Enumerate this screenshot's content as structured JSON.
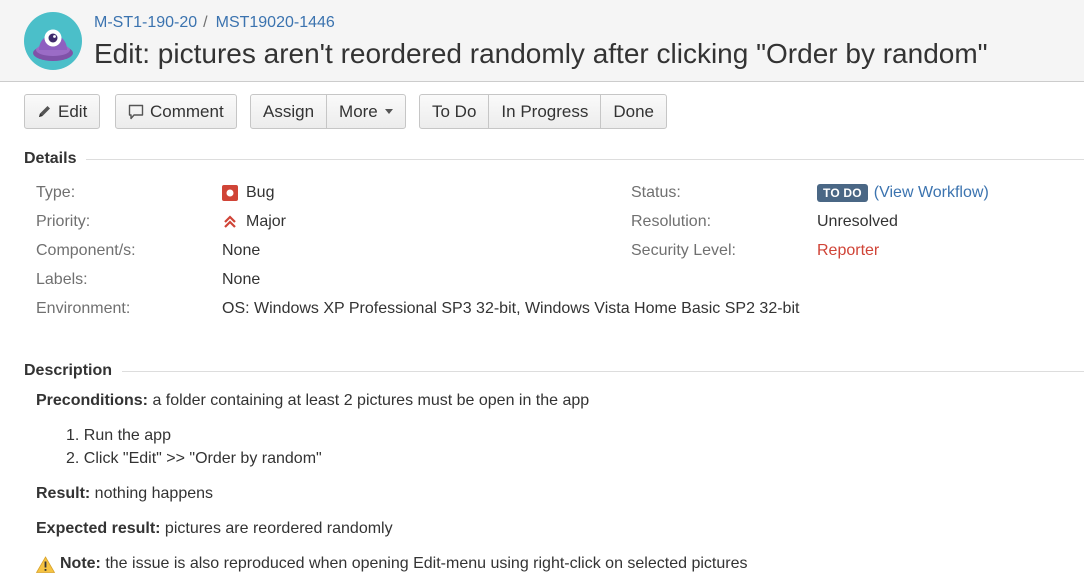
{
  "header": {
    "breadcrumb": {
      "project": "M-ST1-190-20",
      "separator": "/",
      "issue_key": "MST19020-1446"
    },
    "title": "Edit: pictures aren't reordered randomly after clicking \"Order by random\"",
    "avatar_icon": "project-alien-avatar-icon"
  },
  "toolbar": {
    "edit_label": "Edit",
    "comment_label": "Comment",
    "assign_label": "Assign",
    "more_label": "More",
    "todo_label": "To Do",
    "in_progress_label": "In Progress",
    "done_label": "Done"
  },
  "details": {
    "heading": "Details",
    "left": [
      {
        "label": "Type:",
        "value": "Bug",
        "icon": "bug-icon"
      },
      {
        "label": "Priority:",
        "value": "Major",
        "icon": "major-priority-icon"
      },
      {
        "label": "Component/s:",
        "value": "None"
      },
      {
        "label": "Labels:",
        "value": "None"
      },
      {
        "label": "Environment:",
        "value": "OS: Windows XP Professional SP3 32-bit, Windows Vista Home Basic SP2 32-bit"
      }
    ],
    "right": {
      "status_label": "Status:",
      "status_lozenge": "TO DO",
      "view_workflow_open": "(",
      "view_workflow_link": "View Workflow",
      "view_workflow_close": ")",
      "resolution_label": "Resolution:",
      "resolution_value": "Unresolved",
      "security_label": "Security Level:",
      "security_value": "Reporter"
    }
  },
  "description": {
    "heading": "Description",
    "preconditions_label": "Preconditions:",
    "preconditions_text": " a folder containing at least 2 pictures must be open in the app",
    "steps": [
      "1. Run the app",
      "2. Click \"Edit\" >> \"Order by random\""
    ],
    "result_label": "Result:",
    "result_text": " nothing happens",
    "expected_label": "Expected result:",
    "expected_text": " pictures are reordered randomly",
    "note_icon": "warning-icon",
    "note_label": "Note:",
    "note_text": " the issue is also reproduced when opening Edit-menu using right-click on selected pictures"
  },
  "colors": {
    "link": "#3b73af",
    "lozenge": "#4a6785",
    "reporter": "#d04437",
    "bug": "#d04437"
  }
}
